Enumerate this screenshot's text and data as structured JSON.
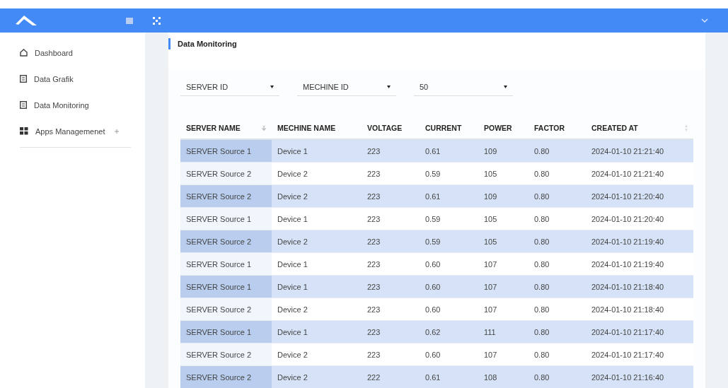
{
  "sidebar": {
    "items": [
      {
        "label": "Dashboard",
        "kind": "home",
        "expandable": false
      },
      {
        "label": "Data Grafik",
        "kind": "document",
        "expandable": false
      },
      {
        "label": "Data Monitoring",
        "kind": "document",
        "expandable": false
      },
      {
        "label": "Apps Managemenet",
        "kind": "grid",
        "expandable": true
      }
    ]
  },
  "page_title": "Data Monitoring",
  "filters": [
    {
      "value": "SERVER ID"
    },
    {
      "value": "MECHINE ID"
    },
    {
      "value": "50"
    }
  ],
  "table": {
    "columns": [
      {
        "label": "SERVER NAME",
        "kind": "sorted"
      },
      {
        "label": "MECHINE NAME",
        "kind": "plain"
      },
      {
        "label": "VOLTAGE",
        "kind": "plain"
      },
      {
        "label": "CURRENT",
        "kind": "plain"
      },
      {
        "label": "POWER",
        "kind": "plain"
      },
      {
        "label": "FACTOR",
        "kind": "plain"
      },
      {
        "label": "CREATED AT",
        "kind": "sortable"
      }
    ],
    "rows": [
      [
        "SERVER Source 1",
        "Device 1",
        "223",
        "0.61",
        "109",
        "0.80",
        "2024-01-10 21:21:40"
      ],
      [
        "SERVER Source 2",
        "Device 2",
        "223",
        "0.59",
        "105",
        "0.80",
        "2024-01-10 21:21:40"
      ],
      [
        "SERVER Source 2",
        "Device 2",
        "223",
        "0.61",
        "109",
        "0.80",
        "2024-01-10 21:20:40"
      ],
      [
        "SERVER Source 1",
        "Device 1",
        "223",
        "0.59",
        "105",
        "0.80",
        "2024-01-10 21:20:40"
      ],
      [
        "SERVER Source 2",
        "Device 2",
        "223",
        "0.59",
        "105",
        "0.80",
        "2024-01-10 21:19:40"
      ],
      [
        "SERVER Source 1",
        "Device 1",
        "223",
        "0.60",
        "107",
        "0.80",
        "2024-01-10 21:19:40"
      ],
      [
        "SERVER Source 1",
        "Device 1",
        "223",
        "0.60",
        "107",
        "0.80",
        "2024-01-10 21:18:40"
      ],
      [
        "SERVER Source 2",
        "Device 2",
        "223",
        "0.60",
        "107",
        "0.80",
        "2024-01-10 21:18:40"
      ],
      [
        "SERVER Source 1",
        "Device 1",
        "223",
        "0.62",
        "111",
        "0.80",
        "2024-01-10 21:17:40"
      ],
      [
        "SERVER Source 2",
        "Device 2",
        "223",
        "0.60",
        "107",
        "0.80",
        "2024-01-10 21:17:40"
      ],
      [
        "SERVER Source 2",
        "Device 2",
        "222",
        "0.61",
        "108",
        "0.80",
        "2024-01-10 21:16:40"
      ]
    ]
  }
}
